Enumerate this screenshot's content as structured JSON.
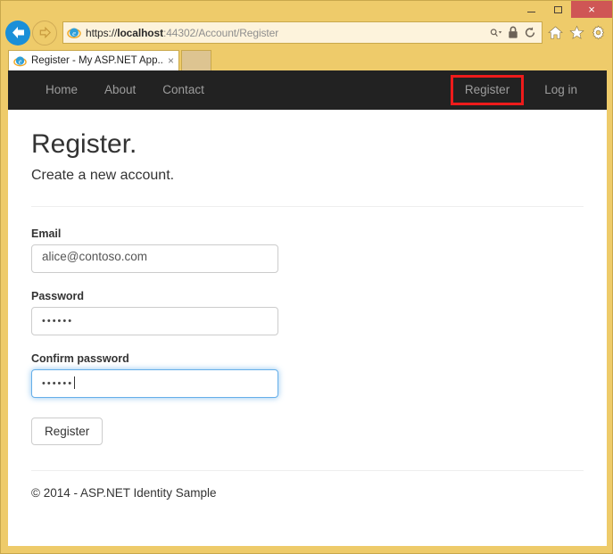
{
  "window": {
    "controls": {
      "minimize": "minimize-button",
      "maximize": "maximize-button",
      "close": "×"
    },
    "frame_color": "#eecb6a"
  },
  "browser": {
    "back_label": "back-button",
    "forward_label": "forward-button",
    "address": {
      "scheme": "https://",
      "host": "localhost",
      "port": ":44302",
      "path": "/",
      "path_highlighted": "Account/Register",
      "full": "https://localhost:44302/Account/Register",
      "highlight_color": "#e8140f"
    },
    "address_icons": [
      "search-dropdown-icon",
      "lock-icon",
      "refresh-icon"
    ],
    "chrome_icons": [
      "home-icon",
      "favorites-star-icon",
      "settings-gear-icon"
    ],
    "tab": {
      "title": "Register - My ASP.NET App...",
      "close": "×"
    },
    "new_tab_label": ""
  },
  "site": {
    "navbar": {
      "background": "#222222",
      "left_links": [
        {
          "label": "Home"
        },
        {
          "label": "About"
        },
        {
          "label": "Contact"
        }
      ],
      "right_links": [
        {
          "label": "Register",
          "highlighted": true,
          "highlight_color": "#ee1b1b"
        },
        {
          "label": "Log in",
          "highlighted": false
        }
      ]
    },
    "page": {
      "title": "Register.",
      "subtitle": "Create a new account."
    },
    "form": {
      "fields": [
        {
          "label": "Email",
          "value": "alice@contoso.com",
          "type": "email",
          "focused": false
        },
        {
          "label": "Password",
          "value": "••••••",
          "type": "password",
          "focused": false
        },
        {
          "label": "Confirm password",
          "value": "••••••",
          "type": "password",
          "focused": true
        }
      ],
      "submit_label": "Register"
    },
    "footer": {
      "text": "© 2014 - ASP.NET Identity Sample"
    }
  }
}
